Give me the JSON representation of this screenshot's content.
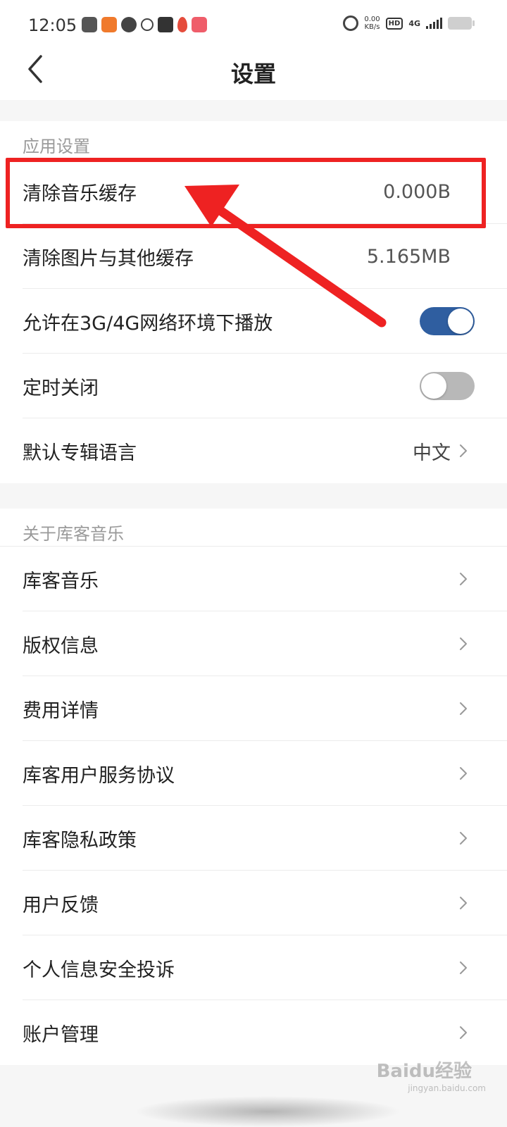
{
  "status_bar": {
    "time": "12:05",
    "net_speed_value": "0.00",
    "net_speed_unit": "KB/s",
    "hd_label": "HD",
    "network_label": "4G"
  },
  "navbar": {
    "title": "设置",
    "back_icon": "chevron-left-icon"
  },
  "app_settings": {
    "header": "应用设置",
    "rows": [
      {
        "label": "清除音乐缓存",
        "value": "0.000B"
      },
      {
        "label": "清除图片与其他缓存",
        "value": "5.165MB"
      },
      {
        "label": "允许在3G/4G网络环境下播放",
        "toggle": "on"
      },
      {
        "label": "定时关闭",
        "toggle": "off"
      },
      {
        "label": "默认专辑语言",
        "value": "中文"
      }
    ]
  },
  "about": {
    "header": "关于库客音乐",
    "rows": [
      {
        "label": "库客音乐"
      },
      {
        "label": "版权信息"
      },
      {
        "label": "费用详情"
      },
      {
        "label": "库客用户服务协议"
      },
      {
        "label": "库客隐私政策"
      },
      {
        "label": "用户反馈"
      },
      {
        "label": "个人信息安全投诉"
      },
      {
        "label": "账户管理"
      }
    ]
  },
  "colors": {
    "toggle_on": "#2f5ea0",
    "toggle_off": "#b8b8b8",
    "annotation": "#ee2222"
  },
  "watermark": {
    "text": "Baidu经验",
    "sub": "jingyan.baidu.com"
  }
}
